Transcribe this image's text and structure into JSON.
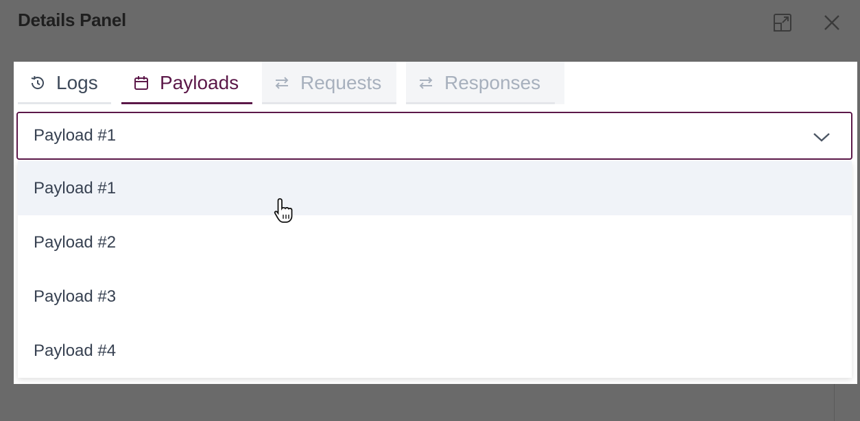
{
  "panel": {
    "title": "Details Panel",
    "expand_icon": "expand-icon",
    "close_icon": "close-icon"
  },
  "tabs": [
    {
      "label": "Logs",
      "icon": "history-icon",
      "state": "normal"
    },
    {
      "label": "Payloads",
      "icon": "calendar-box-icon",
      "state": "active"
    },
    {
      "label": "Requests",
      "icon": "swap-arrows-icon",
      "state": "disabled"
    },
    {
      "label": "Responses",
      "icon": "swap-arrows-icon",
      "state": "disabled"
    }
  ],
  "select": {
    "value": "Payload #1",
    "options": [
      "Payload #1",
      "Payload #2",
      "Payload #3",
      "Payload #4"
    ],
    "hovered_option": "Payload #1",
    "chevron_icon": "chevron-down-icon"
  },
  "colors": {
    "accent": "#5b1748",
    "overlay": "#6a6a6a",
    "text": "#374151",
    "disabled_text": "#a7b0bd",
    "hover_bg": "#f0f3f8"
  },
  "cursor": "hand-pointer-icon"
}
